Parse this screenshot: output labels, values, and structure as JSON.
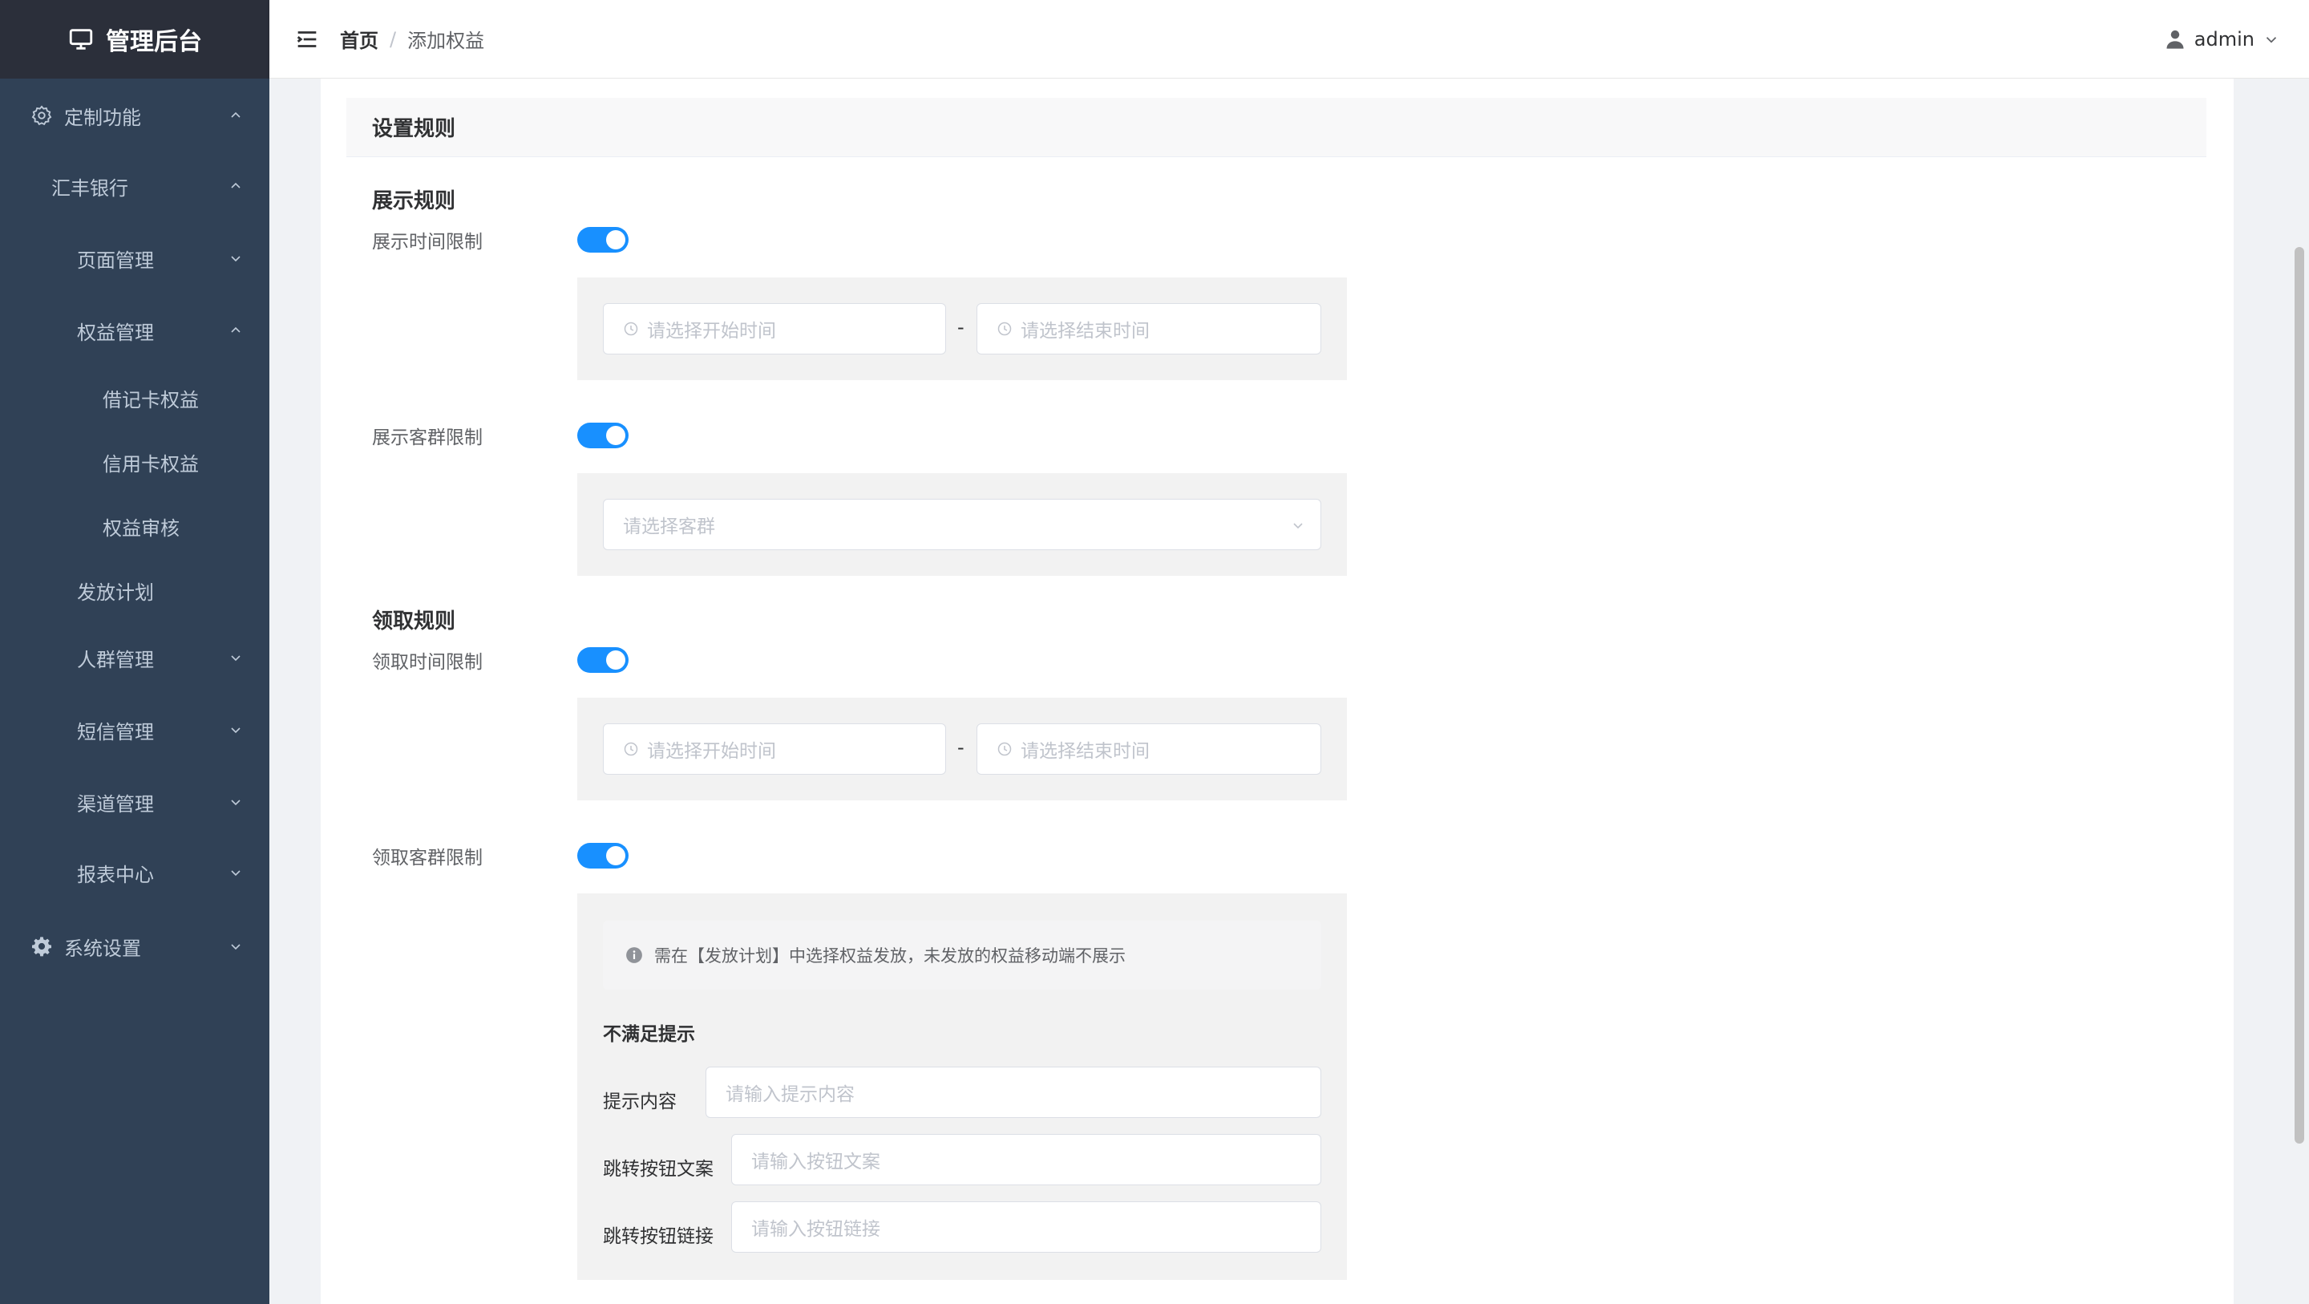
{
  "app": {
    "title": "管理后台"
  },
  "sidebar": {
    "items": [
      {
        "label": "定制功能",
        "icon": "gear-outline-icon",
        "expanded": true
      },
      {
        "label": "汇丰银行",
        "expanded": true
      },
      {
        "label": "页面管理",
        "expanded": false
      },
      {
        "label": "权益管理",
        "expanded": true
      },
      {
        "label": "借记卡权益"
      },
      {
        "label": "信用卡权益"
      },
      {
        "label": "权益审核"
      },
      {
        "label": "发放计划"
      },
      {
        "label": "人群管理",
        "expanded": false
      },
      {
        "label": "短信管理",
        "expanded": false
      },
      {
        "label": "渠道管理",
        "expanded": false
      },
      {
        "label": "报表中心",
        "expanded": false
      },
      {
        "label": "系统设置",
        "icon": "gear-solid-icon",
        "expanded": false
      }
    ]
  },
  "header": {
    "breadcrumb": {
      "home": "首页",
      "separator": "/",
      "current": "添加权益"
    },
    "user": {
      "name": "admin"
    }
  },
  "form": {
    "section_title": "设置规则",
    "display_rules": {
      "title": "展示规则",
      "time_limit": {
        "label": "展示时间限制",
        "enabled": true,
        "start_placeholder": "请选择开始时间",
        "end_placeholder": "请选择结束时间",
        "separator": "-"
      },
      "group_limit": {
        "label": "展示客群限制",
        "enabled": true,
        "placeholder": "请选择客群"
      }
    },
    "claim_rules": {
      "title": "领取规则",
      "time_limit": {
        "label": "领取时间限制",
        "enabled": true,
        "start_placeholder": "请选择开始时间",
        "end_placeholder": "请选择结束时间",
        "separator": "-"
      },
      "group_limit": {
        "label": "领取客群限制",
        "enabled": true,
        "notice": "需在【发放计划】中选择权益发放，未发放的权益移动端不展示",
        "unmet_title": "不满足提示",
        "tip_content": {
          "label": "提示内容",
          "placeholder": "请输入提示内容"
        },
        "button_text": {
          "label": "跳转按钮文案",
          "placeholder": "请输入按钮文案"
        },
        "button_link": {
          "label": "跳转按钮链接",
          "placeholder": "请输入按钮链接"
        }
      }
    }
  },
  "colors": {
    "sidebar_bg": "#304156",
    "logo_bg": "#2b2f3a",
    "accent": "#1890ff",
    "panel_bg": "#f2f2f2"
  }
}
